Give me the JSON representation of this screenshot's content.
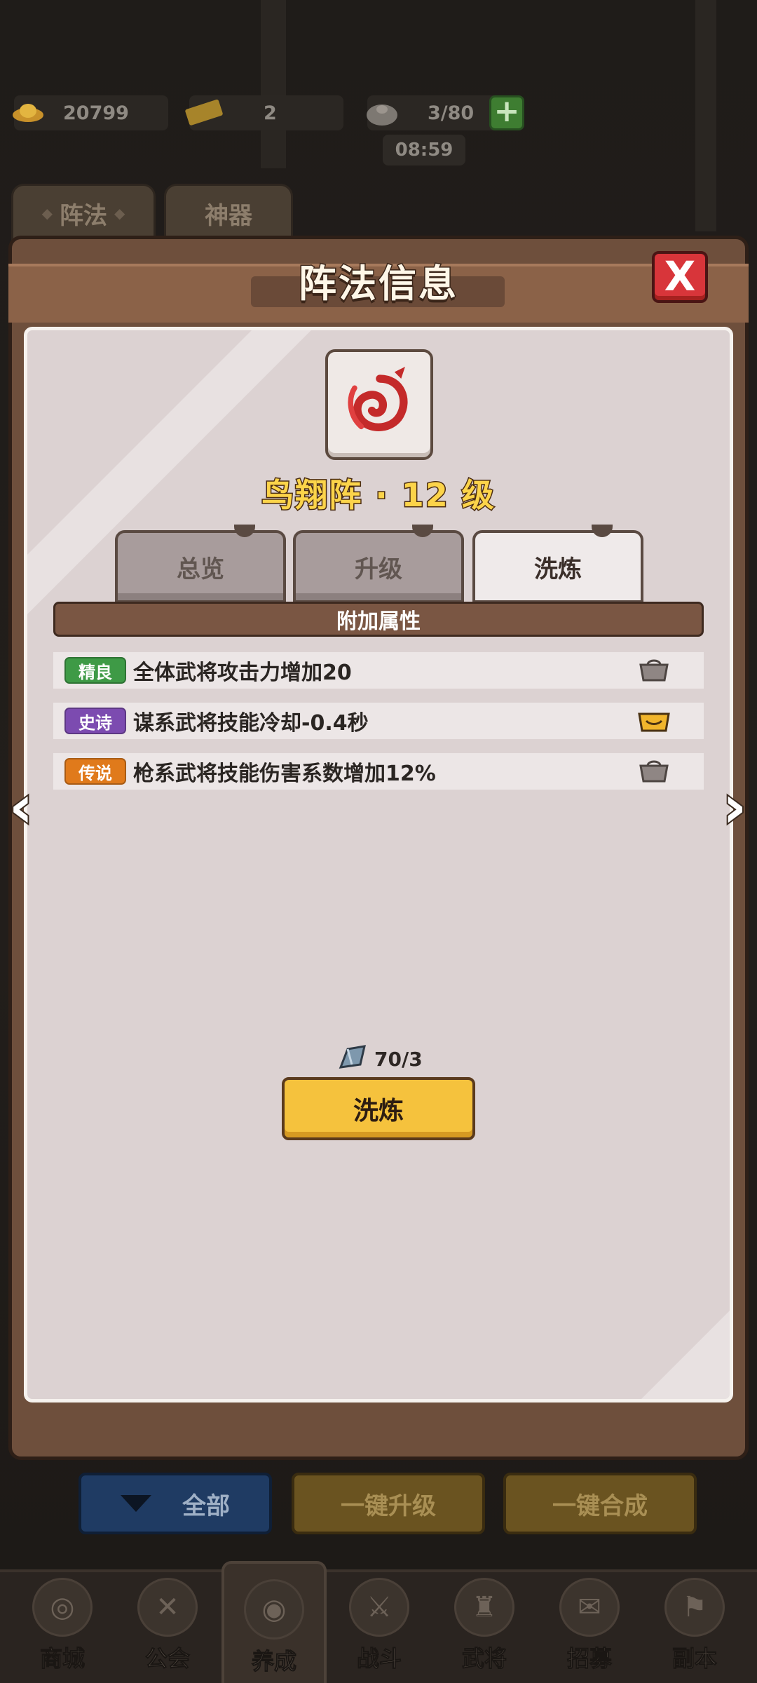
{
  "resources": {
    "gold": "20799",
    "tickets": "2",
    "stamina": "3/80",
    "timer": "08:59"
  },
  "back_tabs": [
    "阵法",
    "神器"
  ],
  "modal": {
    "title": "阵法信息",
    "close_label": "X",
    "formation_name": "鸟翔阵 · 12 级",
    "tabs": [
      {
        "label": "总览",
        "active": false
      },
      {
        "label": "升级",
        "active": false
      },
      {
        "label": "洗炼",
        "active": true
      }
    ],
    "section_title": "附加属性",
    "attributes": [
      {
        "rarity": "精良",
        "color": "#3e9a46",
        "text": "全体武将攻击力增加20",
        "lock": "grey"
      },
      {
        "rarity": "史诗",
        "color": "#7c4bb0",
        "text": "谋系武将技能冷却-0.4秒",
        "lock": "gold"
      },
      {
        "rarity": "传说",
        "color": "#e07a1b",
        "text": "枪系武将技能伤害系数增加12%",
        "lock": "grey"
      }
    ],
    "cost": "70/3",
    "refine_button": "洗炼"
  },
  "bottom_buttons": {
    "all": "全部",
    "upgrade_all": "一键升级",
    "merge_all": "一键合成"
  },
  "nav": [
    {
      "label": "商城",
      "icon": "shop-icon"
    },
    {
      "label": "公会",
      "icon": "guild-icon"
    },
    {
      "label": "养成",
      "icon": "develop-icon",
      "active": true
    },
    {
      "label": "战斗",
      "icon": "battle-icon"
    },
    {
      "label": "武将",
      "icon": "general-icon"
    },
    {
      "label": "招募",
      "icon": "recruit-icon"
    },
    {
      "label": "副本",
      "icon": "dungeon-icon"
    }
  ]
}
